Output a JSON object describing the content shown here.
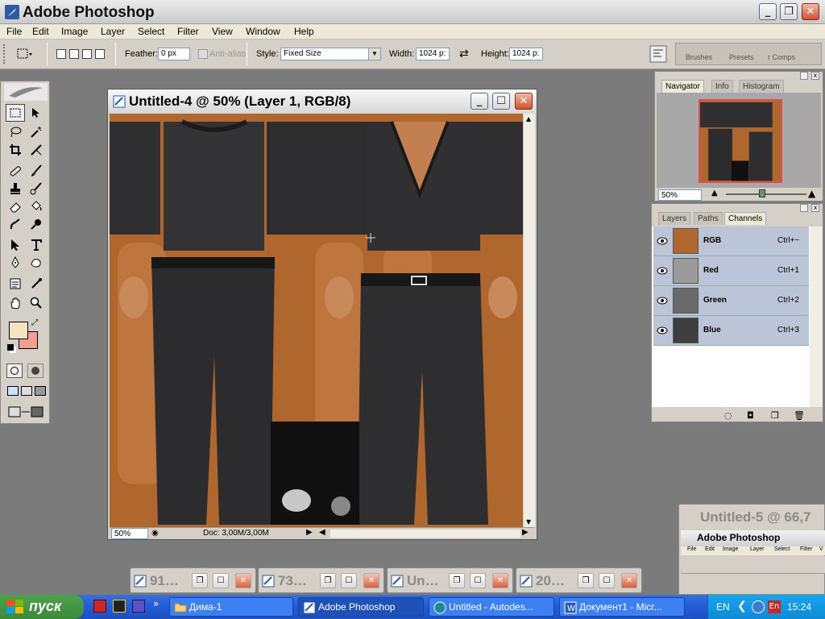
{
  "app": {
    "title": "Adobe Photoshop"
  },
  "menu": [
    "File",
    "Edit",
    "Image",
    "Layer",
    "Select",
    "Filter",
    "View",
    "Window",
    "Help"
  ],
  "options": {
    "feather_label": "Feather:",
    "feather_value": "0 px",
    "antialias_label": "Anti-alias",
    "style_label": "Style:",
    "style_value": "Fixed Size",
    "width_label": "Width:",
    "width_value": "1024 p:",
    "height_label": "Height:",
    "height_value": "1024 p:",
    "wells": [
      "Brushes",
      "Presets",
      "r Comps"
    ]
  },
  "document": {
    "title": "Untitled-4 @ 50% (Layer 1, RGB/8)",
    "zoom": "50%",
    "doc_size": "Doc: 3,00M/3,00M"
  },
  "navigator": {
    "tabs": [
      "Navigator",
      "Info",
      "Histogram"
    ],
    "zoom": "50%",
    "zoom_level": 0.45
  },
  "channels_panel": {
    "tabs": [
      "Layers",
      "Paths",
      "Channels"
    ],
    "rows": [
      {
        "name": "RGB",
        "shortcut": "Ctrl+~"
      },
      {
        "name": "Red",
        "shortcut": "Ctrl+1"
      },
      {
        "name": "Green",
        "shortcut": "Ctrl+2"
      },
      {
        "name": "Blue",
        "shortcut": "Ctrl+3"
      }
    ]
  },
  "colors": {
    "foreground": "#f7e4c0",
    "background": "#f0a090",
    "canvas_skin": "#b0672e"
  },
  "minimized": [
    "91…",
    "73…",
    "Un…",
    "20…"
  ],
  "second_window": {
    "title": "Untitled-5 @ 66,7",
    "app_title": "Adobe Photoshop",
    "menu": [
      "File",
      "Edit",
      "Image",
      "Layer",
      "Select",
      "Filter",
      "V"
    ]
  },
  "taskbar": {
    "start": "пуск",
    "items": [
      "Дима-1",
      "Adobe Photoshop",
      "Untitled - Autodes...",
      "Документ1 - Micr..."
    ],
    "lang": "EN",
    "clock": "15:24"
  }
}
